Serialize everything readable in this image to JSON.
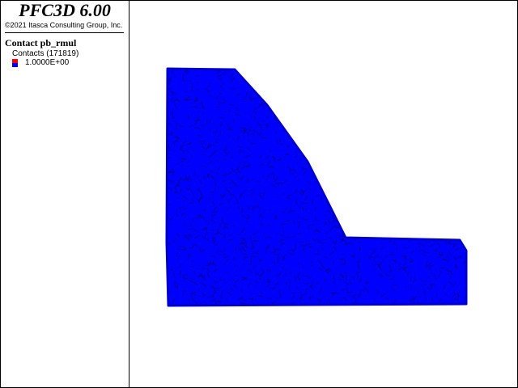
{
  "header": {
    "app_title": "PFC3D 6.00",
    "copyright": "©2021 Itasca Consulting Group, Inc."
  },
  "legend": {
    "plot_item_title": "Contact pb_rmul",
    "contacts_label": "Contacts (171819)",
    "entries": [
      {
        "value_label": "1.0000E+00",
        "swatch_colors": [
          "#ff0000",
          "#0000ff"
        ]
      }
    ]
  },
  "model_view": {
    "fill_color": "#0000ff",
    "texture_color": "#00007a",
    "edge_color": "#0000cc",
    "shape": "dam-section"
  }
}
